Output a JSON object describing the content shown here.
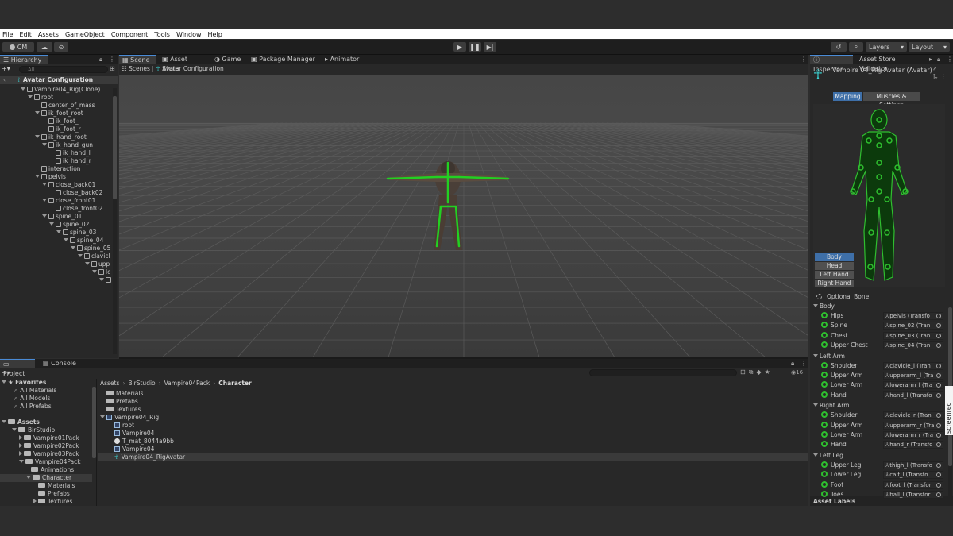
{
  "menu": [
    "File",
    "Edit",
    "Assets",
    "GameObject",
    "Component",
    "Tools",
    "Window",
    "Help"
  ],
  "toolbar": {
    "account": "CM",
    "layers": "Layers",
    "layout": "Layout"
  },
  "hierarchy": {
    "tab": "Hierarchy",
    "search_placeholder": "All",
    "header": "Avatar Configuration",
    "items": [
      {
        "label": "Vampire04_Rig(Clone)",
        "indent": 0,
        "expanded": true
      },
      {
        "label": "root",
        "indent": 1,
        "expanded": true
      },
      {
        "label": "center_of_mass",
        "indent": 2,
        "expanded": false
      },
      {
        "label": "ik_foot_root",
        "indent": 2,
        "expanded": true
      },
      {
        "label": "ik_foot_l",
        "indent": 3,
        "expanded": false
      },
      {
        "label": "ik_foot_r",
        "indent": 3,
        "expanded": false
      },
      {
        "label": "ik_hand_root",
        "indent": 2,
        "expanded": true
      },
      {
        "label": "ik_hand_gun",
        "indent": 3,
        "expanded": true
      },
      {
        "label": "ik_hand_l",
        "indent": 4,
        "expanded": false
      },
      {
        "label": "ik_hand_r",
        "indent": 4,
        "expanded": false
      },
      {
        "label": "interaction",
        "indent": 2,
        "expanded": false
      },
      {
        "label": "pelvis",
        "indent": 2,
        "expanded": true
      },
      {
        "label": "close_back01",
        "indent": 3,
        "expanded": true
      },
      {
        "label": "close_back02",
        "indent": 4,
        "expanded": false
      },
      {
        "label": "close_front01",
        "indent": 3,
        "expanded": true
      },
      {
        "label": "close_front02",
        "indent": 4,
        "expanded": false
      },
      {
        "label": "spine_01",
        "indent": 3,
        "expanded": true
      },
      {
        "label": "spine_02",
        "indent": 4,
        "expanded": true
      },
      {
        "label": "spine_03",
        "indent": 5,
        "expanded": true
      },
      {
        "label": "spine_04",
        "indent": 6,
        "expanded": true
      },
      {
        "label": "spine_05",
        "indent": 7,
        "expanded": true
      },
      {
        "label": "clavicl",
        "indent": 8,
        "expanded": true
      },
      {
        "label": "upp",
        "indent": 9,
        "expanded": true
      },
      {
        "label": "lc",
        "indent": 10,
        "expanded": true
      },
      {
        "label": "",
        "indent": 11,
        "expanded": true
      }
    ]
  },
  "scene_tabs": [
    "Scene",
    "Asset Store",
    "Game",
    "Package Manager",
    "Animator"
  ],
  "scene_breadcrumb": {
    "root": "Scenes",
    "current": "Avatar Configuration"
  },
  "project": {
    "tabs": [
      "Project",
      "Console"
    ],
    "favorites_label": "Favorites",
    "favorites": [
      "All Materials",
      "All Models",
      "All Prefabs"
    ],
    "assets_label": "Assets",
    "tree": [
      {
        "label": "BirStudio",
        "indent": 1
      },
      {
        "label": "Vampire01Pack",
        "indent": 2
      },
      {
        "label": "Vampire02Pack",
        "indent": 2
      },
      {
        "label": "Vampire03Pack",
        "indent": 2
      },
      {
        "label": "Vampire04Pack",
        "indent": 2
      },
      {
        "label": "Animations",
        "indent": 3
      },
      {
        "label": "Character",
        "indent": 3
      },
      {
        "label": "Materials",
        "indent": 4
      },
      {
        "label": "Prefabs",
        "indent": 4
      },
      {
        "label": "Textures",
        "indent": 4
      }
    ],
    "breadcrumb": [
      "Assets",
      "BirStudio",
      "Vampire04Pack",
      "Character"
    ],
    "hidden_count": "16",
    "files": [
      {
        "label": "Materials",
        "indent": 0
      },
      {
        "label": "Prefabs",
        "indent": 0
      },
      {
        "label": "Textures",
        "indent": 0
      },
      {
        "label": "Vampire04_Rig",
        "indent": 0
      },
      {
        "label": "root",
        "indent": 1
      },
      {
        "label": "Vampire04",
        "indent": 1
      },
      {
        "label": "T_mat_8044a9bb",
        "indent": 1
      },
      {
        "label": "Vampire04",
        "indent": 1
      },
      {
        "label": "Vampire04_RigAvatar",
        "indent": 1
      }
    ]
  },
  "inspector": {
    "tabs": [
      "Inspector",
      "Asset Store Validator"
    ],
    "title": "Vampire 04_Rig Avatar (Avatar)",
    "mode_tabs": [
      "Mapping",
      "Muscles & Settings"
    ],
    "body_buttons": [
      "Body",
      "Head",
      "Left Hand",
      "Right Hand"
    ],
    "optional_bone": "Optional Bone",
    "sections": [
      {
        "name": "Body",
        "bones": [
          {
            "label": "Hips",
            "target": "pelvis (Transfo"
          },
          {
            "label": "Spine",
            "target": "spine_02 (Tran"
          },
          {
            "label": "Chest",
            "target": "spine_03 (Tran"
          },
          {
            "label": "Upper Chest",
            "target": "spine_04 (Tran"
          }
        ]
      },
      {
        "name": "Left Arm",
        "bones": [
          {
            "label": "Shoulder",
            "target": "clavicle_l (Tran"
          },
          {
            "label": "Upper Arm",
            "target": "upperarm_l (Tra"
          },
          {
            "label": "Lower Arm",
            "target": "lowerarm_l (Tra"
          },
          {
            "label": "Hand",
            "target": "hand_l (Transfo"
          }
        ]
      },
      {
        "name": "Right Arm",
        "bones": [
          {
            "label": "Shoulder",
            "target": "clavicle_r (Tran"
          },
          {
            "label": "Upper Arm",
            "target": "upperarm_r (Tra"
          },
          {
            "label": "Lower Arm",
            "target": "lowerarm_r (Tra"
          },
          {
            "label": "Hand",
            "target": "hand_r (Transfo"
          }
        ]
      },
      {
        "name": "Left Leg",
        "bones": [
          {
            "label": "Upper Leg",
            "target": "thigh_l (Transfo"
          },
          {
            "label": "Lower Leg",
            "target": "calf_l (Transfo"
          },
          {
            "label": "Foot",
            "target": "foot_l (Transfor"
          },
          {
            "label": "Toes",
            "target": "ball_l (Transfor"
          }
        ]
      }
    ],
    "asset_labels": "Asset Labels"
  },
  "watermark": "screenrec",
  "colors": {
    "bone_green": "#2fbf2f",
    "accent_blue": "#4a8bd6",
    "selected": "#3a3a3a"
  }
}
